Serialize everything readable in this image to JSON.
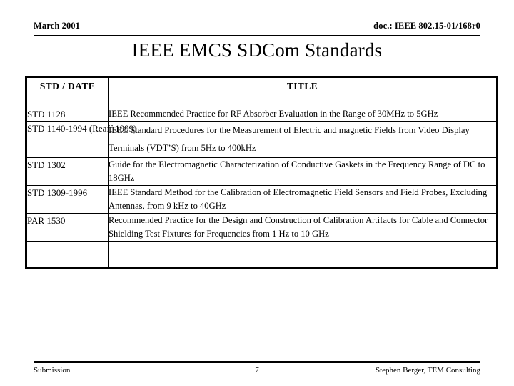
{
  "header": {
    "date": "March 2001",
    "doc_id": "doc.: IEEE 802.15-01/168r0"
  },
  "title": "IEEE EMCS SDCom Standards",
  "table": {
    "columns": [
      "STD / DATE",
      "TITLE"
    ],
    "rows": [
      {
        "std": "STD 1128",
        "title": "IEEE Recommended Practice for RF Absorber Evaluation in the Range of 30MHz to 5GHz",
        "spacing": "normal"
      },
      {
        "std": "STD 1140-1994 (Reaff 1999)",
        "title": "IEEE Standard Procedures for the Measurement of Electric and magnetic Fields from Video Display Terminals (VDT’S) from 5Hz to 400kHz",
        "spacing": "loose"
      },
      {
        "std": "STD 1302",
        "title": "Guide for the Electromagnetic Characterization of Conductive Gaskets in the Frequency Range of DC to 18GHz",
        "spacing": "normal"
      },
      {
        "std": "STD 1309-1996",
        "title": "IEEE Standard Method for the Calibration of Electromagnetic Field Sensors and Field Probes, Excluding Antennas, from 9 kHz to 40GHz",
        "spacing": "normal"
      },
      {
        "std": "PAR 1530",
        "title": "Recommended Practice for the Design and Construction of Calibration Artifacts for Cable and Connector Shielding Test Fixtures for Frequencies from 1 Hz to 10 GHz",
        "spacing": "normal"
      },
      {
        "std": "",
        "title": "",
        "spacing": "normal"
      }
    ]
  },
  "footer": {
    "left": "Submission",
    "page_number": "7",
    "right": "Stephen Berger, TEM Consulting"
  }
}
